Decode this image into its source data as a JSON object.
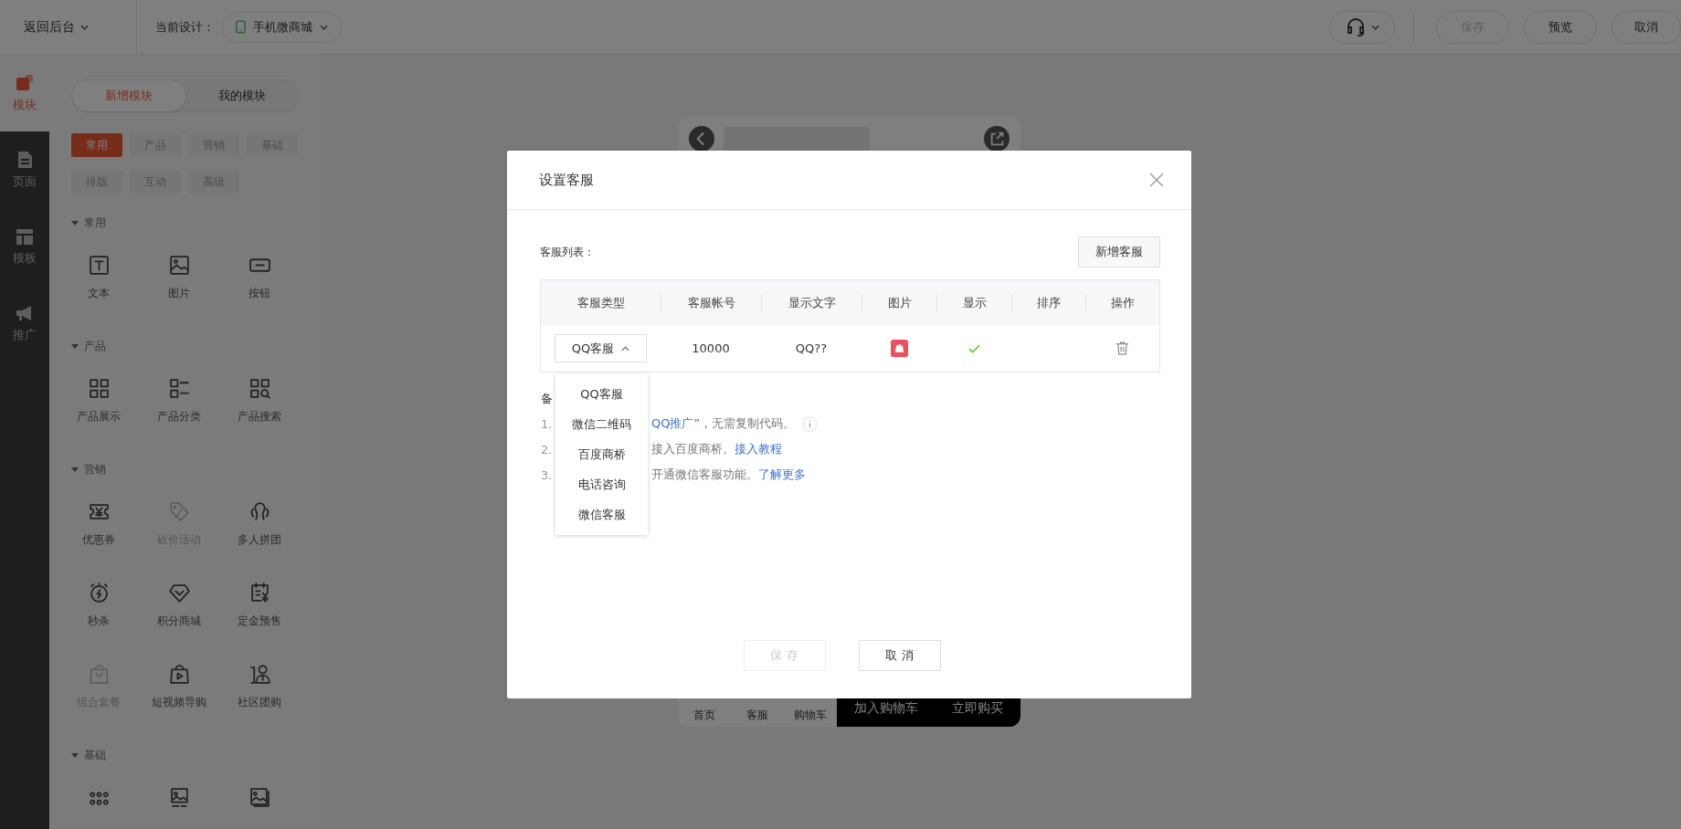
{
  "topbar": {
    "back": "返回后台",
    "design_label": "当前设计：",
    "design": "手机微商城",
    "buttons": [
      {
        "label": "保存",
        "disabled": true
      },
      {
        "label": "预览",
        "disabled": false
      },
      {
        "label": "取消",
        "disabled": false
      }
    ]
  },
  "rail": [
    {
      "label": "模块",
      "selected": true
    },
    {
      "label": "页面",
      "selected": false
    },
    {
      "label": "模板",
      "selected": false
    },
    {
      "label": "推广",
      "selected": false
    }
  ],
  "module_tabs": [
    {
      "label": "新增模块",
      "selected": true
    },
    {
      "label": "我的模块",
      "selected": false
    }
  ],
  "categories": [
    {
      "label": "常用",
      "selected": true
    },
    {
      "label": "产品",
      "selected": false
    },
    {
      "label": "营销",
      "selected": false
    },
    {
      "label": "基础",
      "selected": false
    },
    {
      "label": "排版",
      "selected": false
    },
    {
      "label": "互动",
      "selected": false
    },
    {
      "label": "高级",
      "selected": false
    }
  ],
  "sections": [
    {
      "title": "常用",
      "expanded": true,
      "items": [
        {
          "label": "文本",
          "disabled": false
        },
        {
          "label": "图片",
          "disabled": false
        },
        {
          "label": "按钮",
          "disabled": false
        }
      ]
    },
    {
      "title": "产品",
      "expanded": true,
      "items": [
        {
          "label": "产品展示",
          "disabled": false
        },
        {
          "label": "产品分类",
          "disabled": false
        },
        {
          "label": "产品搜索",
          "disabled": false
        }
      ]
    },
    {
      "title": "营销",
      "expanded": true,
      "items": [
        {
          "label": "优惠券",
          "disabled": false
        },
        {
          "label": "砍价活动",
          "disabled": true
        },
        {
          "label": "多人拼团",
          "disabled": false
        },
        {
          "label": "秒杀",
          "disabled": false
        },
        {
          "label": "积分商城",
          "disabled": false
        },
        {
          "label": "定金预售",
          "disabled": false
        },
        {
          "label": "组合套餐",
          "disabled": true
        },
        {
          "label": "短视频导购",
          "disabled": false
        },
        {
          "label": "社区团购",
          "disabled": false
        }
      ]
    },
    {
      "title": "基础",
      "expanded": true,
      "items": [
        {
          "disabled": false
        },
        {
          "disabled": false
        },
        {
          "disabled": false
        }
      ]
    }
  ],
  "preview": {
    "bottom_tabs": [
      "首页",
      "客服",
      "购物车"
    ],
    "actions": [
      "加入购物车",
      "立即购买"
    ]
  },
  "dialog": {
    "title": "设置客服",
    "list_label": "客服列表：",
    "add_button": "新增客服",
    "columns": [
      "客服类型",
      "客服帐号",
      "显示文字",
      "图片",
      "显示",
      "排序",
      "操作"
    ],
    "rows": [
      {
        "type": "QQ客服",
        "account": "10000",
        "text": "QQ??",
        "shown": true
      }
    ],
    "dropdown": {
      "open": true,
      "options": [
        "QQ客服",
        "微信二维码",
        "百度商桥",
        "电话咨询",
        "微信客服"
      ]
    },
    "notes_heading": "备",
    "notes": [
      {
        "number": "1.",
        "parts": [
          {
            "text": "QQ推广”",
            "link": true
          },
          {
            "text": "，无需复制代码。",
            "link": false
          }
        ],
        "info": true
      },
      {
        "number": "2.",
        "parts": [
          {
            "text": "接入百度商桥。",
            "link": false
          },
          {
            "text": "接入教程",
            "link": true
          }
        ],
        "info": false
      },
      {
        "number": "3.",
        "parts": [
          {
            "text": "开通微信客服功能。",
            "link": false
          },
          {
            "text": "了解更多",
            "link": true
          }
        ],
        "info": false
      }
    ],
    "buttons": [
      {
        "label": "保 存",
        "disabled": true
      },
      {
        "label": "取 消",
        "disabled": false
      }
    ]
  }
}
